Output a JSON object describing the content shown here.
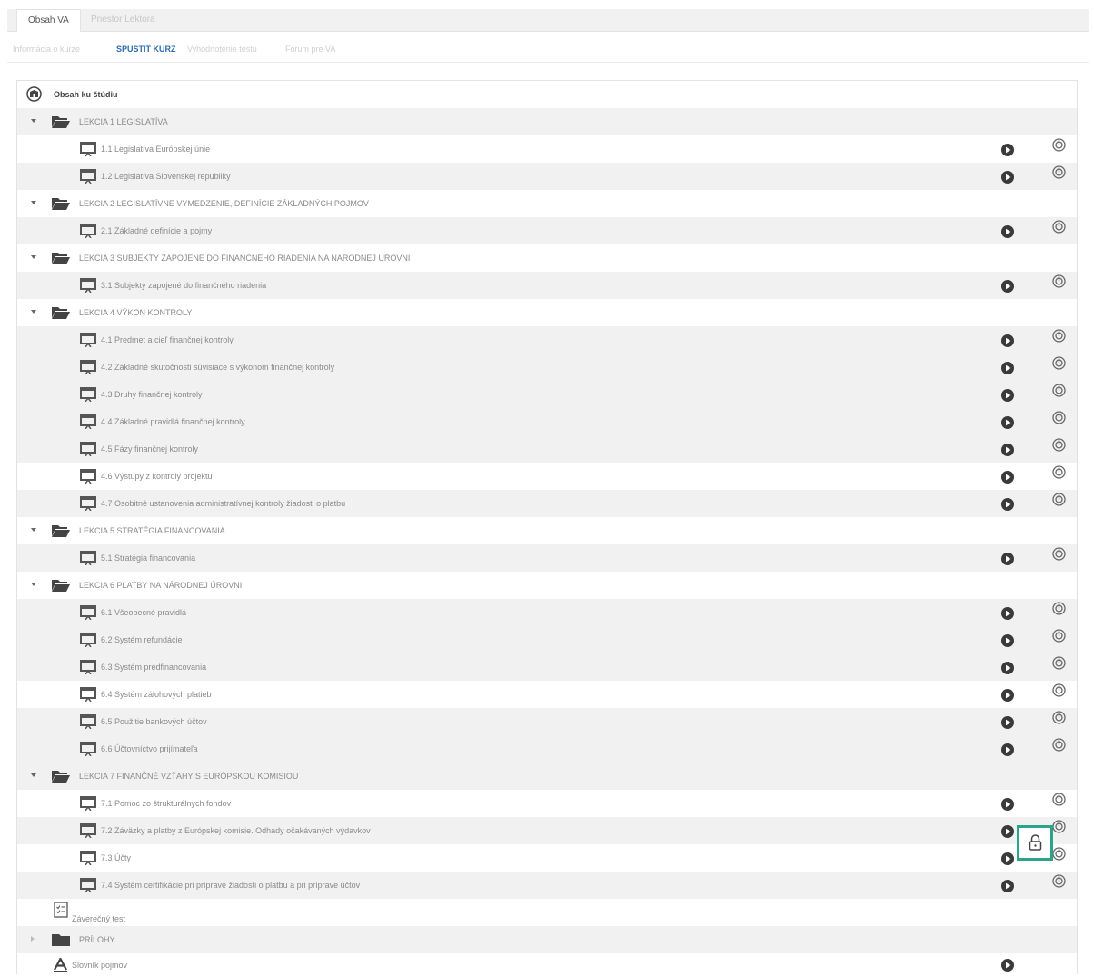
{
  "top_tabs": [
    "Obsah VA",
    "Priestor Lektora"
  ],
  "sub_tabs": [
    "Informácia o kurze",
    "SPUSTIŤ KURZ",
    "Vyhodnotenie testu",
    "Fórum pre VA"
  ],
  "tree": {
    "header": "Obsah ku štúdiu",
    "lessons": [
      {
        "title": "LEKCIA 1 LEGISLATÍVA",
        "items": [
          "1.1 Legislatíva Európskej únie",
          "1.2 Legislatíva Slovenskej republiky"
        ]
      },
      {
        "title": "LEKCIA 2 LEGISLATÍVNE VYMEDZENIE, DEFINÍCIE ZÁKLADNÝCH POJMOV",
        "items": [
          "2.1 Základné definície a pojmy"
        ]
      },
      {
        "title": "LEKCIA 3 SUBJEKTY ZAPOJENÉ DO FINANČNÉHO RIADENIA NA NÁRODNEJ ÚROVNI",
        "items": [
          "3.1 Subjekty zapojené do finančného riadenia"
        ]
      },
      {
        "title": "LEKCIA 4 VÝKON KONTROLY",
        "items": [
          "4.1 Predmet a cieľ finančnej kontroly",
          "4.2 Základné skutočnosti súvisiace s výkonom finančnej kontroly",
          "4.3 Druhy finančnej kontroly",
          "4.4 Základné pravidlá finančnej kontroly",
          "4.5 Fázy finančnej kontroly",
          "4.6 Výstupy z kontroly projektu",
          "4.7 Osobitné ustanovenia administratívnej kontroly žiadosti o platbu"
        ]
      },
      {
        "title": "LEKCIA 5 STRATÉGIA FINANCOVANIA",
        "items": [
          "5.1 Stratégia financovania"
        ]
      },
      {
        "title": "LEKCIA 6 PLATBY NA NÁRODNEJ ÚROVNI",
        "items": [
          "6.1 Všeobecné pravidlá",
          "6.2 Systém refundácie",
          "6.3 Systém predfinancovania",
          "6.4 Systém zálohových platieb",
          "6.5 Použitie bankových účtov",
          "6.6 Účtovníctvo prijímateľa"
        ]
      },
      {
        "title": "LEKCIA 7 FINANČNÉ VZŤAHY S EURÓPSKOU KOMISIOU",
        "items": [
          "7.1 Pomoc zo štrukturálnych fondov",
          "7.2 Záväzky a platby z Európskej komisie. Odhady očakávaných výdavkov",
          "7.3 Účty",
          "7.4 Systém certifikácie pri príprave žiadosti o platbu a pri príprave účtov"
        ]
      }
    ],
    "final_test": "Záverečný test",
    "attachments": "PRÍLOHY",
    "glossary": "Slovník pojmov"
  },
  "colors": {
    "active_sub_tab": "#2d6cae",
    "lock_highlight": "#2aa58a"
  },
  "icons": {
    "header": "home-book-icon",
    "lesson": "folder-open-icon",
    "item": "monitor-icon",
    "play": "play-circle-icon",
    "stats": "stats-icon",
    "test": "test-sheet-icon",
    "lock": "lock-icon",
    "glossary": "letter-a-icon",
    "attachments": "folder-closed-icon"
  }
}
